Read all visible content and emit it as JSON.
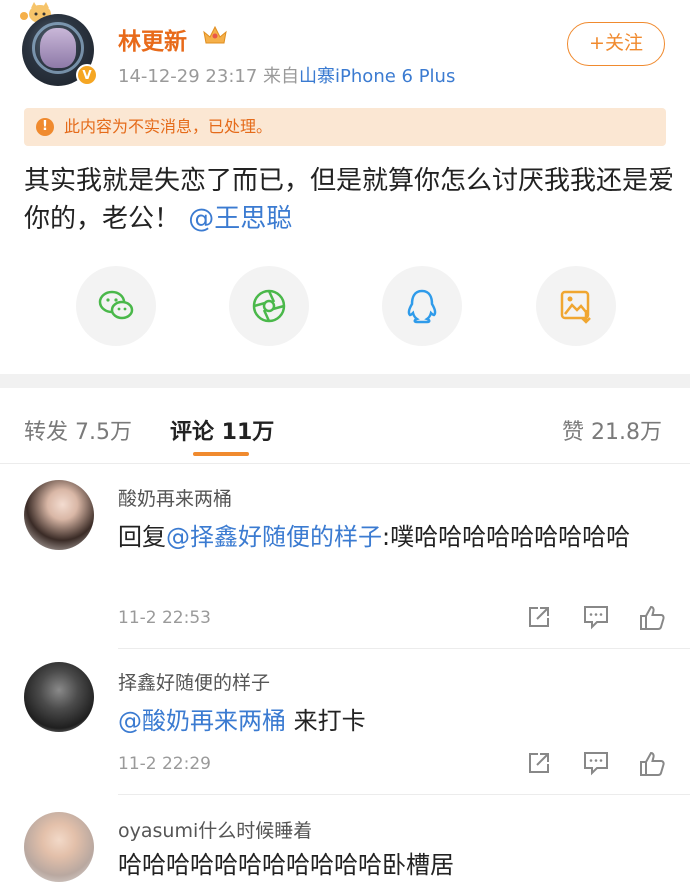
{
  "post": {
    "username": "林更新",
    "time": "14-12-29 23:17",
    "source_prefix": "来自",
    "source": "山寨iPhone 6 Plus",
    "follow_label": "+关注",
    "notice": "此内容为不实消息，已处理。",
    "text_before": "其实我就是失恋了而已，但是就算你怎么讨厌我我还是爱你的，老公！",
    "mention": "@王思聪"
  },
  "share": [
    "wechat-icon",
    "moments-icon",
    "qq-icon",
    "save-image-icon"
  ],
  "tabs": {
    "repost": "转发 7.5万",
    "comment": "评论 11万",
    "like": "赞 21.8万"
  },
  "comments": [
    {
      "name": "酸奶再来两桶",
      "reply_prefix": "回复",
      "mention": "@择鑫好随便的样子",
      "text": ":噗哈哈哈哈哈哈哈哈哈",
      "time": "11-2 22:53"
    },
    {
      "name": "择鑫好随便的样子",
      "mention": "@酸奶再来两桶",
      "text": " 来打卡",
      "time": "11-2 22:29"
    },
    {
      "name": "oyasumi什么时候睡着",
      "text": "哈哈哈哈哈哈哈哈哈哈哈卧槽居"
    }
  ],
  "colors": {
    "accent": "#f08a2e",
    "link": "#3b7bd1",
    "username": "#e86a1a"
  }
}
